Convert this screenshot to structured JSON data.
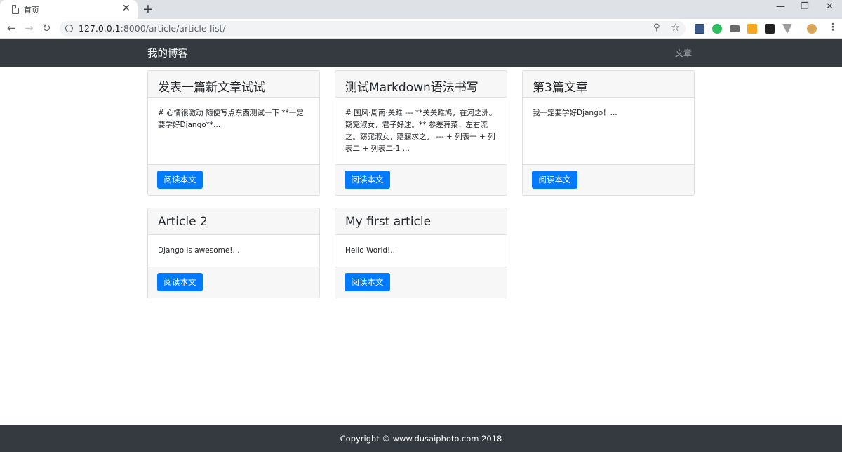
{
  "browser": {
    "tab_title": "首页",
    "url_host": "127.0.0.1",
    "url_rest": ":8000/article/article-list/"
  },
  "navbar": {
    "brand": "我的博客",
    "link": "文章"
  },
  "articles": [
    {
      "title": "发表一篇新文章试试",
      "excerpt": "# 心情很激动 随便写点东西测试一下 **一定要学好Django**...",
      "button": "阅读本文"
    },
    {
      "title": "测试Markdown语法书写",
      "excerpt": "# 国风·周南·关雎 --- **关关雎鸠，在河之洲。窈窕淑女，君子好逑。** 参差荇菜，左右流之。窈窕淑女，寤寐求之。 --- + 列表一 + 列表二 + 列表二-1 ...",
      "button": "阅读本文"
    },
    {
      "title": "第3篇文章",
      "excerpt": "我一定要学好Django！...",
      "button": "阅读本文"
    },
    {
      "title": "Article 2",
      "excerpt": "Django is awesome!...",
      "button": "阅读本文"
    },
    {
      "title": "My first article",
      "excerpt": "Hello World!...",
      "button": "阅读本文"
    }
  ],
  "footer": {
    "copyright": "Copyright © www.dusaiphoto.com 2018"
  },
  "colors": {
    "navbar_bg": "#343a40",
    "button_bg": "#007bff",
    "card_header_bg": "#f7f7f7"
  }
}
